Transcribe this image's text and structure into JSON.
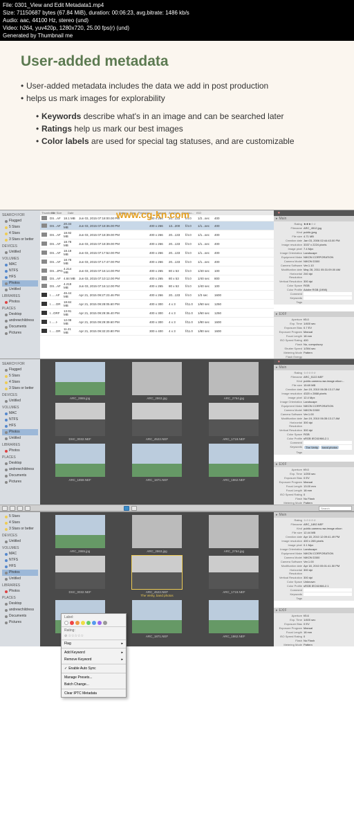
{
  "header": {
    "l1": "File: 0301_View and Edit Metadata1.mp4",
    "l2": "Size: 71150687 bytes (67.84 MiB), duration: 00:06:23, avg.bitrate: 1486 kb/s",
    "l3": "Audio: aac, 44100 Hz, stereo (und)",
    "l4": "Video: h264, yuv420p, 1280x720, 25.00 fps(r) (und)",
    "l5": "Generated by Thumbnail me"
  },
  "slide": {
    "title": "User-added metadata",
    "b1": "User-added metadata includes the data we add in post production",
    "b2": "helps us mark images for explorability",
    "s1a": "Keywords",
    "s1b": " describe what's in an image and can be searched later",
    "s2a": "Ratings",
    "s2b": " help us mark our best images",
    "s3a": "Color labels",
    "s3b": " are used for special tag statuses, and are customizable"
  },
  "sidebar": {
    "search_for": "SEARCH FOR",
    "flagged": "Flagged",
    "stars5": "5 Stars",
    "stars4": "4 Stars",
    "stars3b": "3 Stars or better",
    "devices": "DEVICES",
    "untitled": "Untitled",
    "volumes": "VOLUMES",
    "mac": "MAC",
    "ntfs": "NTFS",
    "hfs": "HFS",
    "photos": "Photos",
    "libraries": "LIBRARIES",
    "places": "PLACES",
    "desktop": "Desktop",
    "user": "andrewchildress",
    "documents": "Documents",
    "pictures": "Pictures"
  },
  "listcols": {
    "c1": "Thumbnail",
    "c2": "File Size",
    "c3": "Date",
    "c4": "Rating",
    "c5": "Flag",
    "c6": "Pixel size",
    "c7": "Aspect",
    "c8": "Aperture",
    "c9": "Exposu...",
    "c10": "ISO"
  },
  "rows": [
    {
      "n": "DS...AF",
      "s": "18.1 MB",
      "d": "Jun 03, 2015 07:18:00.00 PM",
      "px": "400 x 266",
      "a": "20...133",
      "ap": "f/4.0",
      "ex": "1/2...sec",
      "iso": "400"
    },
    {
      "n": "DS...AF",
      "s": "20.34 MB",
      "d": "Jun 03, 2015 07:18:36.00 PM",
      "px": "400 x 266",
      "a": "13...200",
      "ap": "f/4.0",
      "ex": "1/1...sec",
      "iso": "400"
    },
    {
      "n": "DS...AF",
      "s": "18.92 MB",
      "d": "Jun 03, 2015 07:18:39.00 PM",
      "px": "400 x 266",
      "a": "20...133",
      "ap": "f/4.0",
      "ex": "1/1...sec",
      "iso": "400"
    },
    {
      "n": "DS...AF",
      "s": "18.78 MB",
      "d": "Jun 03, 2015 07:18:39.00 PM",
      "px": "400 x 266",
      "a": "20...133",
      "ap": "f/4.0",
      "ex": "1/1...sec",
      "iso": "400"
    },
    {
      "n": "DS...AF",
      "s": "18.19 MB",
      "d": "Jun 03, 2015 07:17:52.00 PM",
      "px": "400 x 266",
      "a": "20...133",
      "ap": "f/4.0",
      "ex": "1/1...sec",
      "iso": "400"
    },
    {
      "n": "DS...AF",
      "s": "18.78 MB",
      "d": "Jun 03, 2015 07:17:47.00 PM",
      "px": "400 x 266",
      "a": "20...133",
      "ap": "f/4.0",
      "ex": "1/1...sec",
      "iso": "400"
    },
    {
      "n": "DS...JPG",
      "s": "4.214 MB",
      "d": "Jun 03, 2015 07:16:14.00 PM",
      "px": "400 x 265",
      "a": "80 x 53",
      "ap": "f/4.0",
      "ex": "1/40 sec",
      "iso": "100"
    },
    {
      "n": "DS...AF",
      "s": "4.84 MB",
      "d": "Jun 03, 2015 07:10:12.00 PM",
      "px": "400 x 265",
      "a": "80 x 53",
      "ap": "f/4.0",
      "ex": "1/40 sec",
      "iso": "800"
    },
    {
      "n": "DS...AF",
      "s": "4.219 MB",
      "d": "Jun 03, 2015 07:16:12.00 PM",
      "px": "400 x 265",
      "a": "80 x 53",
      "ap": "f/4.0",
      "ex": "1/40 sec",
      "iso": "100"
    },
    {
      "n": "I......AF",
      "s": "46.44 MB",
      "d": "Apr 21, 2015 09:27:23.46 PM",
      "px": "400 x 266",
      "a": "20...133",
      "ap": "f/4.0",
      "ex": "1/3 sec",
      "iso": "1600"
    },
    {
      "n": "I......OR",
      "s": "18.84 MB",
      "d": "Apr 21, 2015 09:28:05.60 PM",
      "px": "400 x 300",
      "a": "4 x 3",
      "ap": "f/11.0",
      "ex": "1/60 sec",
      "iso": "1250"
    },
    {
      "n": "I...ORF",
      "s": "13.91 MB",
      "d": "Apr 21, 2015 09:29:36.40 PM",
      "px": "400 x 300",
      "a": "4 x 3",
      "ap": "f/11.0",
      "ex": "1/60 sec",
      "iso": "1250"
    },
    {
      "n": "I......I-",
      "s": "12.08 MB",
      "d": "Apr 21, 2015 09:29:39.60 PM",
      "px": "400 x 300",
      "a": "4 x 3",
      "ap": "f/11.0",
      "ex": "1/80 sec",
      "iso": "1600"
    },
    {
      "n": "I......OR",
      "s": "11.21 MB",
      "d": "Apr 21, 2015 09:32:20.80 PM",
      "px": "300 x 400",
      "a": "4 x 3",
      "ap": "f/11.0",
      "ex": "1/80 sec",
      "iso": "1600"
    }
  ],
  "meta1": {
    "main": "Main",
    "rating_l": "Rating",
    "rating_v": "★★★☆☆",
    "fname_l": "Filename",
    "fname_v": "ARC_4512.jpg",
    "kind_l": "Kind",
    "kind_v": "public.jpeg",
    "fsize_l": "File size",
    "fsize_v": "4.71 MB",
    "cdate_l": "Creation date",
    "cdate_v": "Jan 03, 2006 02:44:43.00 PM",
    "ires_l": "Image resolution",
    "ires_v": "3337 x 2224 pixels",
    "ipix_l": "Image pixel",
    "ipix_v": "7.4 Mpx",
    "iori_l": "Image Orientation",
    "iori_v": "Landscape",
    "emake_l": "Equipment Make",
    "emake_v": "NIKON CORPORATION",
    "cmodel_l": "Camera Model",
    "cmodel_v": "NIKON D300",
    "csw_l": "Camera Software",
    "csw_v": "Ver.1.10",
    "mdate_l": "Modification date",
    "mdate_v": "May 28, 2011 05:31:09.00 AM",
    "hres_l": "Horizontal Resolution",
    "hres_v": "240 dpi",
    "vres_l": "Vertical Resolution",
    "vres_v": "300 dpi",
    "cspace_l": "Color Space",
    "cspace_v": "RGB",
    "cprof_l": "Color Profile",
    "cprof_v": "Adobe RGB (1998)",
    "comm_l": "Comment",
    "comm_v": "",
    "keys_l": "Keywords",
    "keys_v": "",
    "tags_l": "Tags",
    "exif": "EXIF",
    "ap_l": "Aperture",
    "ap_v": "f/5.0",
    "et_l": "Exp. Time",
    "et_v": "1/400 sec",
    "eb_l": "Exposure Bias",
    "eb_v": "0.7 EV",
    "ep_l": "Exposure Program",
    "ep_v": "Manual",
    "fl_l": "Focal Length",
    "fl_v": "18 mm",
    "iso_l": "ISO Speed Rating",
    "iso_v": "400",
    "flash_l": "Flash",
    "flash_v": "No, compulsory",
    "ss_l": "Shutter Speed",
    "ss_v": "1/394 sec",
    "mm_l": "Metering Mode",
    "mm_v": "Pattern",
    "fe_l": "Flash Energy",
    "fe_v": ""
  },
  "grid2": {
    "g1": "ARC_2865.jpg",
    "g2": "ARC_2863.jpg",
    "g3": "ARC_2764.jpg",
    "g4": "DSC_0032.NEF",
    "g5": "ARC_4522.NEF",
    "g6": "ARC_1719.NEF",
    "g7": "ARC_1859.NEF",
    "g8": "ARC_1871.NEF",
    "g9": "ARC_1862.NEF"
  },
  "meta2": {
    "fname_v": "ARC_5122.NEF",
    "kind_v": "public.camera-raw-image.nikon...",
    "fsize_v": "15.69 MB",
    "cdate_v": "Jun 19, 2010 06:35:13.17 AM",
    "ires_v": "4320 x 2868 pixels",
    "ipix_v": "12.4 Mpx",
    "iori_v": "Landscape",
    "emake_v": "NIKON CORPORATION",
    "cmodel_v": "NIKON D300",
    "csw_v": "Ver.1.00",
    "mdate_v": "Jun 19, 2010 06:35:13.17 AM",
    "hres_v": "300 dpi",
    "vres_v": "300 dpi",
    "cspace_v": "RGB",
    "cprof_v": "sRGB IEC61966-2.1",
    "kw1": "The Verity",
    "kw2": "band photos",
    "ap_v": "f/9.0",
    "et_v": "1/200 sec",
    "eb_v": "0 EV",
    "ep_v": "Manual",
    "fl_l": "Focal Length",
    "fl_v": "13.00 mm",
    "fl2_v": "18 mm",
    "iso_v": "0",
    "flash_v": "No Flash",
    "mm_v": "Pattern"
  },
  "grid3": {
    "g1": "ARC_2865.jpg",
    "g2": "ARC_2863.jpg",
    "g3": "ARC_2764.jpg",
    "g4": "DSC_0032.NEF",
    "g5": "ARC_4522.NEF",
    "g5b": "The Verity, band photos",
    "g6": "ARC_1719.NEF",
    "g7": "ARC_1859.NEF",
    "g8": "ARC_1871.NEF",
    "g9": "ARC_1862.NEF"
  },
  "meta3": {
    "fname_v": "ARC_1892.NEF",
    "kind_v": "public.camera-raw-image.nikon",
    "fsize_v": "12.44 MB",
    "cdate_v": "Apr 18, 2010 12:09:41.49 PM",
    "ires_v": "400 x 265 pixels",
    "ipix_v": "0.1 Mpx",
    "iori_v": "Landscape",
    "emake_v": "NIKON CORPORATION",
    "cmodel_v": "NIKON D300",
    "csw_v": "Ver.1.00",
    "mdate_v": "Apr 18, 2010 05:01:41.50 PM",
    "hres_v": "300 dpi",
    "vres_v": "300 dpi",
    "cspace_v": "Unknown",
    "cprof_v": "sRGB IEC61966-2.1",
    "ap_v": "f/5.6",
    "et_v": "1/400 sec",
    "eb_v": "0 EV",
    "ep_v": "Manual",
    "fl_v": "18 mm",
    "iso_v": "0",
    "flash_v": "No Flash",
    "mm_v": "Pattern"
  },
  "context": {
    "label": "Label:",
    "rating": "Rating:",
    "flag": "Flag",
    "add_keyword": "Add Keyword",
    "remove_keyword": "Remove Keyword",
    "enable_auto": "Enable Auto Sync",
    "manage": "Manage Presets...",
    "batch": "Batch Change...",
    "clear": "Clear IPTC Metadata"
  },
  "watermark": "www.cg-kn.com",
  "search": "Search"
}
